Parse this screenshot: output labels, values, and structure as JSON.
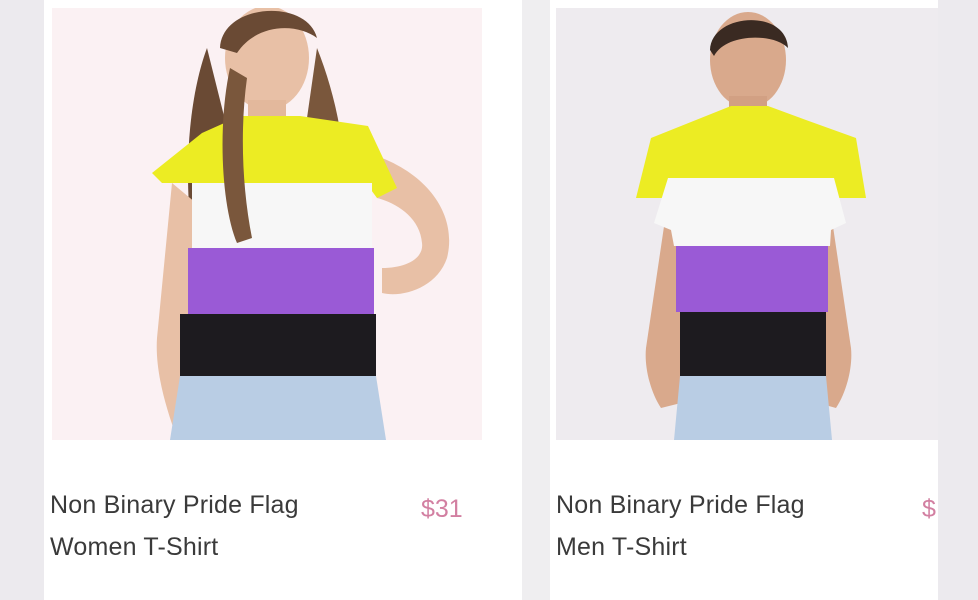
{
  "products": [
    {
      "name": "Non Binary Pride Flag Women T-Shirt",
      "price": "$31"
    },
    {
      "name": "Non Binary Pride Flag Men T-Shirt",
      "price": "$"
    }
  ],
  "colors": {
    "flag_yellow": "#ecec23",
    "flag_white": "#f7f7f7",
    "flag_purple": "#9a5ad6",
    "flag_black": "#1d1b1f",
    "jeans": "#b9cde4",
    "price": "#d27fa1",
    "title_text": "#3a3a3a"
  }
}
